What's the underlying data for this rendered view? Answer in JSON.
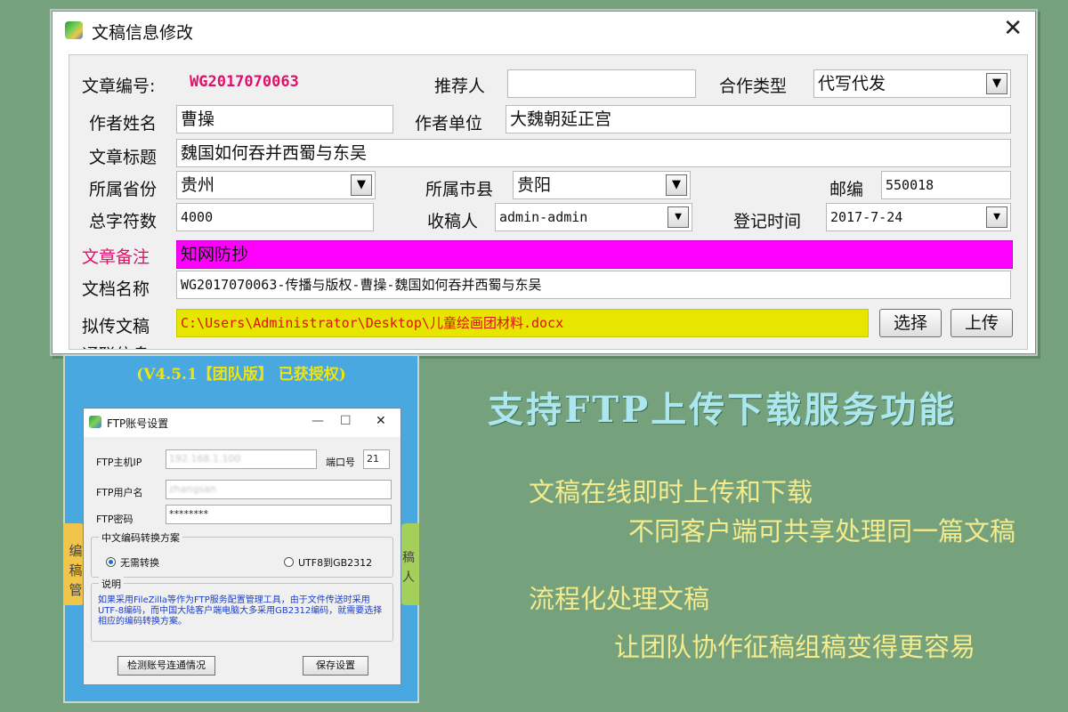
{
  "main_window": {
    "title": "文稿信息修改",
    "fields": {
      "article_no_label": "文章编号:",
      "article_no_value": "WG2017070063",
      "recommender_label": "推荐人",
      "recommender_value": "",
      "coop_type_label": "合作类型",
      "coop_type_value": "代写代发",
      "author_name_label": "作者姓名",
      "author_name_value": "曹操",
      "author_unit_label": "作者单位",
      "author_unit_value": "大魏朝延正宫",
      "article_title_label": "文章标题",
      "article_title_value": "魏国如何吞并西蜀与东吴",
      "province_label": "所属省份",
      "province_value": "贵州",
      "city_label": "所属市县",
      "city_value": "贵阳",
      "postcode_label": "邮编",
      "postcode_value": "550018",
      "word_count_label": "总字符数",
      "word_count_value": "4000",
      "receiver_label": "收稿人",
      "receiver_value": "admin-admin",
      "reg_time_label": "登记时间",
      "reg_time_value": "2017-7-24",
      "remark_label": "文章备注",
      "remark_value": "知网防抄",
      "doc_name_label": "文档名称",
      "doc_name_value": "WG2017070063-传播与版权-曹操-魏国如何吞并西蜀与东吴",
      "upload_label": "拟传文稿",
      "upload_path": "C:\\Users\\Administrator\\Desktop\\儿童绘画团材料.docx"
    },
    "buttons": {
      "choose": "选择",
      "upload": "上传"
    },
    "partial_text": "通联信息"
  },
  "license_panel": {
    "version": "(V4.5.1【团队版】 已获授权)",
    "side_left": "编稿管",
    "side_right": "稿人"
  },
  "ftp_dialog": {
    "title": "FTP账号设置",
    "host_label": "FTP主机IP",
    "host_value": "192.168.1.100",
    "port_label": "端口号",
    "port_value": "21",
    "user_label": "FTP用户名",
    "user_value": "zhangsan",
    "password_label": "FTP密码",
    "password_value": "********",
    "encoding_group": "中文编码转换方案",
    "option_none": "无需转换",
    "option_utf8": "UTF8到GB2312",
    "note_group": "说明",
    "note_text": "如果采用FileZilla等作为FTP服务配置管理工具，由于文件传送时采用UTF-8编码，而中国大陆客户端电脑大多采用GB2312编码，就需要选择相应的编码转换方案。",
    "test_button": "检测账号连通情况",
    "save_button": "保存设置"
  },
  "promo": {
    "headline": "支持FTP上传下载服务功能",
    "line1": "文稿在线即时上传和下载",
    "line2": "不同客户端可共享处理同一篇文稿",
    "line3": "流程化处理文稿",
    "line4": "让团队协作征稿组稿变得更容易"
  }
}
